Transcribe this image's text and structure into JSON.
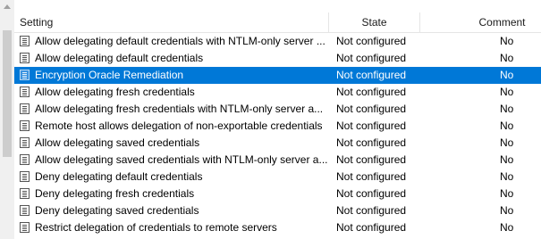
{
  "columns": {
    "setting": "Setting",
    "state": "State",
    "comment": "Comment"
  },
  "rows": [
    {
      "setting": "Allow delegating default credentials with NTLM-only server ...",
      "state": "Not configured",
      "comment": "No"
    },
    {
      "setting": "Allow delegating default credentials",
      "state": "Not configured",
      "comment": "No"
    },
    {
      "setting": "Encryption Oracle Remediation",
      "state": "Not configured",
      "comment": "No",
      "selected": true
    },
    {
      "setting": "Allow delegating fresh credentials",
      "state": "Not configured",
      "comment": "No"
    },
    {
      "setting": "Allow delegating fresh credentials with NTLM-only server a...",
      "state": "Not configured",
      "comment": "No"
    },
    {
      "setting": "Remote host allows delegation of non-exportable credentials",
      "state": "Not configured",
      "comment": "No"
    },
    {
      "setting": "Allow delegating saved credentials",
      "state": "Not configured",
      "comment": "No"
    },
    {
      "setting": "Allow delegating saved credentials with NTLM-only server a...",
      "state": "Not configured",
      "comment": "No"
    },
    {
      "setting": "Deny delegating default credentials",
      "state": "Not configured",
      "comment": "No"
    },
    {
      "setting": "Deny delegating fresh credentials",
      "state": "Not configured",
      "comment": "No"
    },
    {
      "setting": "Deny delegating saved credentials",
      "state": "Not configured",
      "comment": "No"
    },
    {
      "setting": "Restrict delegation of credentials to remote servers",
      "state": "Not configured",
      "comment": "No"
    }
  ],
  "colors": {
    "selection": "#0078d7"
  },
  "icons": {
    "row": "policy-setting-icon"
  }
}
